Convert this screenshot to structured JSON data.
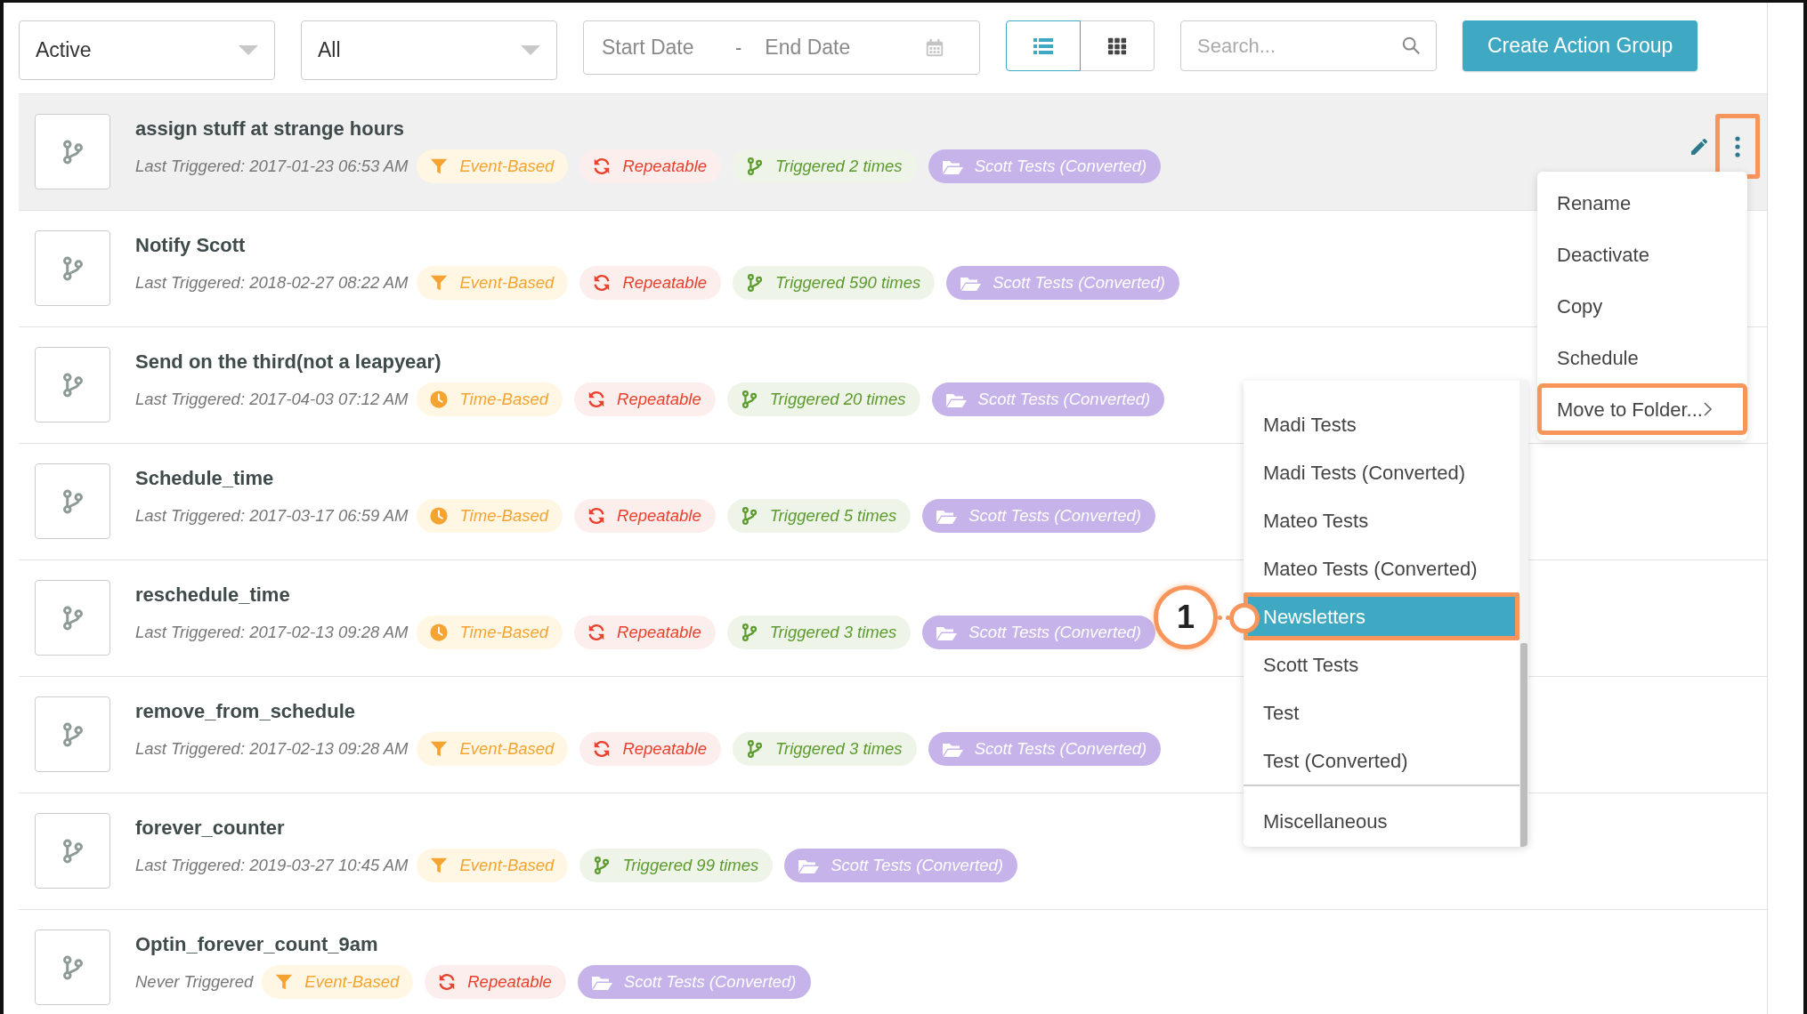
{
  "filters": {
    "status": {
      "value": "Active"
    },
    "type": {
      "value": "All"
    },
    "date_range": {
      "start_placeholder": "Start Date",
      "separator": "-",
      "end_placeholder": "End Date"
    },
    "views": [
      {
        "kind": "list",
        "selected": true
      },
      {
        "kind": "grid",
        "selected": false
      }
    ],
    "search": {
      "placeholder": "Search..."
    },
    "create_button": "Create Action Group"
  },
  "rows": [
    {
      "name": "assign stuff at strange hours",
      "last_triggered": "Last Triggered: 2017-01-23 06:53 AM",
      "selected": true,
      "actions": {
        "annotated": true
      },
      "badges": [
        {
          "kind": "event",
          "label": "Event-Based"
        },
        {
          "kind": "repeatable",
          "label": "Repeatable"
        },
        {
          "kind": "triggered",
          "label": "Triggered 2 times"
        },
        {
          "kind": "folder",
          "label": "Scott Tests (Converted)"
        }
      ]
    },
    {
      "name": "Notify Scott",
      "last_triggered": "Last Triggered: 2018-02-27 08:22 AM",
      "selected": false,
      "badges": [
        {
          "kind": "event",
          "label": "Event-Based"
        },
        {
          "kind": "repeatable",
          "label": "Repeatable"
        },
        {
          "kind": "triggered",
          "label": "Triggered 590 times"
        },
        {
          "kind": "folder",
          "label": "Scott Tests (Converted)"
        }
      ]
    },
    {
      "name": "Send on the third(not a leapyear)",
      "last_triggered": "Last Triggered: 2017-04-03 07:12 AM",
      "selected": false,
      "badges": [
        {
          "kind": "time",
          "label": "Time-Based"
        },
        {
          "kind": "repeatable",
          "label": "Repeatable"
        },
        {
          "kind": "triggered",
          "label": "Triggered 20 times"
        },
        {
          "kind": "folder",
          "label": "Scott Tests (Converted)"
        }
      ]
    },
    {
      "name": "Schedule_time",
      "last_triggered": "Last Triggered: 2017-03-17 06:59 AM",
      "selected": false,
      "badges": [
        {
          "kind": "time",
          "label": "Time-Based"
        },
        {
          "kind": "repeatable",
          "label": "Repeatable"
        },
        {
          "kind": "triggered",
          "label": "Triggered 5 times"
        },
        {
          "kind": "folder",
          "label": "Scott Tests (Converted)"
        }
      ]
    },
    {
      "name": "reschedule_time",
      "last_triggered": "Last Triggered: 2017-02-13 09:28 AM",
      "selected": false,
      "badges": [
        {
          "kind": "time",
          "label": "Time-Based"
        },
        {
          "kind": "repeatable",
          "label": "Repeatable"
        },
        {
          "kind": "triggered",
          "label": "Triggered 3 times"
        },
        {
          "kind": "folder",
          "label": "Scott Tests (Converted)"
        }
      ]
    },
    {
      "name": "remove_from_schedule",
      "last_triggered": "Last Triggered: 2017-02-13 09:28 AM",
      "selected": false,
      "badges": [
        {
          "kind": "event",
          "label": "Event-Based"
        },
        {
          "kind": "repeatable",
          "label": "Repeatable"
        },
        {
          "kind": "triggered",
          "label": "Triggered 3 times"
        },
        {
          "kind": "folder",
          "label": "Scott Tests (Converted)"
        }
      ]
    },
    {
      "name": "forever_counter",
      "last_triggered": "Last Triggered: 2019-03-27 10:45 AM",
      "selected": false,
      "badges": [
        {
          "kind": "event",
          "label": "Event-Based"
        },
        {
          "kind": "triggered",
          "label": "Triggered 99 times"
        },
        {
          "kind": "folder",
          "label": "Scott Tests (Converted)"
        }
      ]
    },
    {
      "name": "Optin_forever_count_9am",
      "last_triggered": "Never Triggered",
      "selected": false,
      "badges": [
        {
          "kind": "event",
          "label": "Event-Based"
        },
        {
          "kind": "repeatable",
          "label": "Repeatable"
        },
        {
          "kind": "folder",
          "label": "Scott Tests (Converted)"
        }
      ]
    }
  ],
  "context_menu": {
    "items": [
      {
        "label": "Rename",
        "kind": "action",
        "annotated": false
      },
      {
        "label": "Deactivate",
        "kind": "action",
        "annotated": false
      },
      {
        "label": "Copy",
        "kind": "action",
        "annotated": false
      },
      {
        "label": "Schedule",
        "kind": "action",
        "annotated": false
      },
      {
        "label": "Move to Folder...",
        "kind": "submenu",
        "annotated": true
      }
    ]
  },
  "folder_menu": {
    "groups": [
      {
        "items": [
          {
            "label": "Madi Tests",
            "selected": false,
            "annotated": false
          },
          {
            "label": "Madi Tests (Converted)",
            "selected": false,
            "annotated": false
          },
          {
            "label": "Mateo Tests",
            "selected": false,
            "annotated": false
          },
          {
            "label": "Mateo Tests (Converted)",
            "selected": false,
            "annotated": false
          },
          {
            "label": "Newsletters",
            "selected": true,
            "annotated": true
          },
          {
            "label": "Scott Tests",
            "selected": false,
            "annotated": false
          },
          {
            "label": "Test",
            "selected": false,
            "annotated": false
          },
          {
            "label": "Test (Converted)",
            "selected": false,
            "annotated": false
          }
        ]
      },
      {
        "items": [
          {
            "label": "Miscellaneous",
            "selected": false,
            "annotated": false
          }
        ]
      }
    ]
  },
  "callout": {
    "label": "1"
  }
}
